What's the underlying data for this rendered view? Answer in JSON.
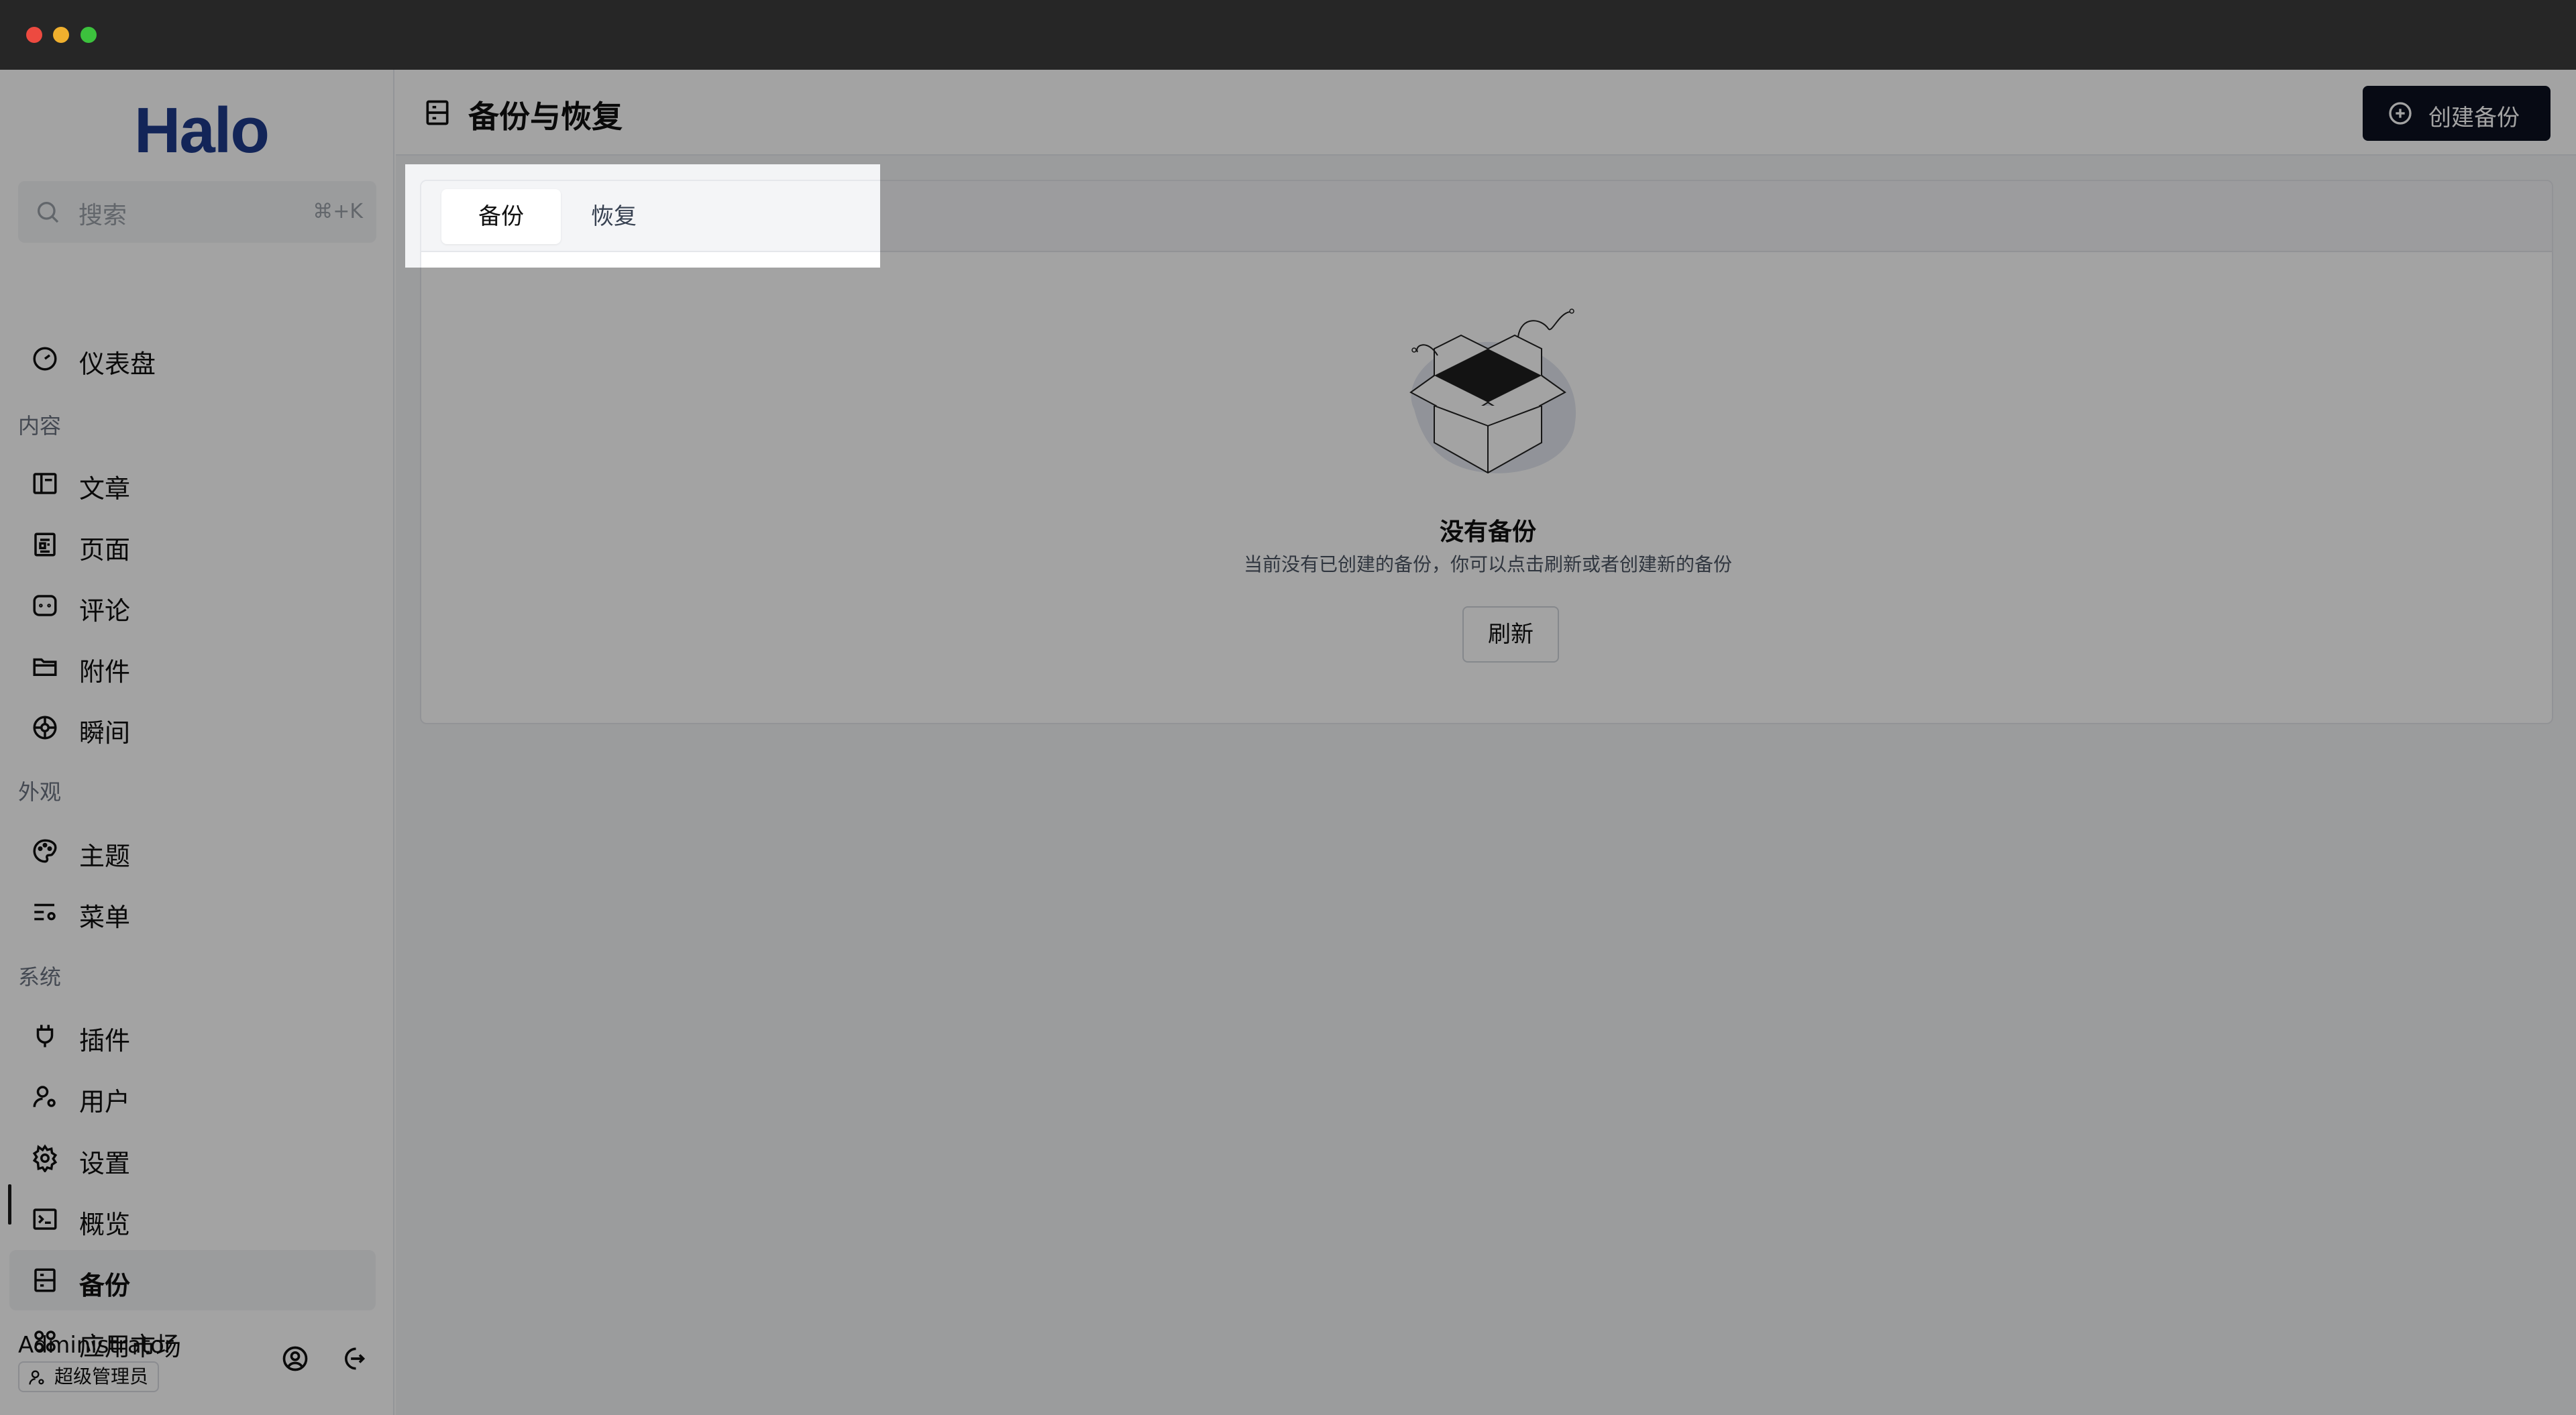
{
  "window": {
    "controls": [
      "close",
      "minimize",
      "maximize"
    ]
  },
  "sidebar": {
    "logo": "Halo",
    "search": {
      "placeholder": "搜索",
      "shortcut": "⌘+K"
    },
    "dashboard": {
      "label": "仪表盘",
      "icon": "dashboard-icon"
    },
    "sections": {
      "content": "内容",
      "appearance": "外观",
      "system": "系统"
    },
    "content_items": [
      {
        "label": "文章",
        "icon": "post-icon"
      },
      {
        "label": "页面",
        "icon": "page-icon"
      },
      {
        "label": "评论",
        "icon": "comment-icon"
      },
      {
        "label": "附件",
        "icon": "folder-icon"
      },
      {
        "label": "瞬间",
        "icon": "moment-icon"
      }
    ],
    "appearance_items": [
      {
        "label": "主题",
        "icon": "palette-icon"
      },
      {
        "label": "菜单",
        "icon": "menu-settings-icon"
      }
    ],
    "system_items": [
      {
        "label": "插件",
        "icon": "plug-icon"
      },
      {
        "label": "用户",
        "icon": "user-settings-icon"
      },
      {
        "label": "设置",
        "icon": "gear-icon"
      },
      {
        "label": "概览",
        "icon": "terminal-icon"
      },
      {
        "label": "备份",
        "icon": "backup-icon",
        "active": true
      },
      {
        "label": "应用市场",
        "icon": "apps-icon"
      }
    ],
    "user": {
      "name": "Administrator",
      "role": "超级管理员"
    }
  },
  "header": {
    "title": "备份与恢复",
    "create_button": "创建备份"
  },
  "tabs": [
    {
      "label": "备份",
      "active": true
    },
    {
      "label": "恢复",
      "active": false
    }
  ],
  "empty_state": {
    "title": "没有备份",
    "message": "当前没有已创建的备份，你可以点击刷新或者创建新的备份",
    "refresh_label": "刷新"
  },
  "colors": {
    "accent": "#0b1120",
    "logo": "#1e3a8a",
    "overlay": "rgba(0,0,0,0.36)"
  }
}
